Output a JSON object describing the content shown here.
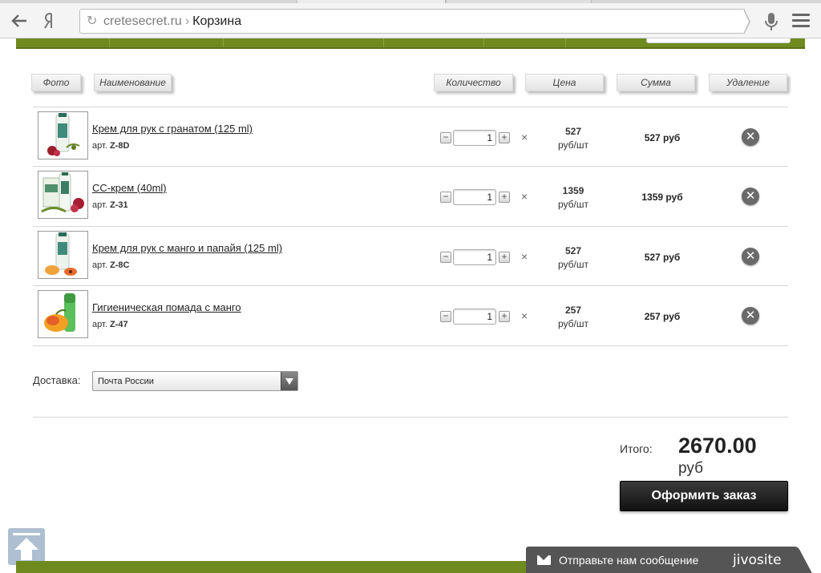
{
  "browser": {
    "url_domain": "cretesecret.ru",
    "url_separator": "›",
    "page_title": "Корзина"
  },
  "cart": {
    "headers": {
      "photo": "Фото",
      "name": "Наименование",
      "quantity": "Количество",
      "price": "Цена",
      "sum": "Сумма",
      "delete": "Удаление"
    },
    "items": [
      {
        "name": "Крем для рук с гранатом (125 ml)",
        "sku_prefix": "арт.",
        "sku": "Z-8D",
        "qty": "1",
        "price": "527",
        "price_unit": "руб/шт",
        "sum": "527 руб"
      },
      {
        "name": "СС-крем (40ml)",
        "sku_prefix": "арт.",
        "sku": "Z-31",
        "qty": "1",
        "price": "1359",
        "price_unit": "руб/шт",
        "sum": "1359 руб"
      },
      {
        "name": "Крем для рук с манго и папайя (125 ml)",
        "sku_prefix": "арт.",
        "sku": "Z-8C",
        "qty": "1",
        "price": "527",
        "price_unit": "руб/шт",
        "sum": "527 руб"
      },
      {
        "name": "Гигиеническая помада с манго",
        "sku_prefix": "арт.",
        "sku": "Z-47",
        "qty": "1",
        "price": "257",
        "price_unit": "руб/шт",
        "sum": "257 руб"
      }
    ],
    "qty_minus": "−",
    "qty_plus": "+",
    "times": "×",
    "delete_glyph": "✕"
  },
  "delivery": {
    "label": "Доставка:",
    "selected": "Почта России"
  },
  "totals": {
    "label": "Итого:",
    "value": "2670.00",
    "currency": "руб",
    "checkout_label": "Оформить заказ"
  },
  "chat": {
    "text": "Отправьте нам сообщение",
    "logo": "jivosite"
  },
  "colors": {
    "site_green": "#6f8a1f",
    "checkout_bg": "#1a1a1a"
  }
}
